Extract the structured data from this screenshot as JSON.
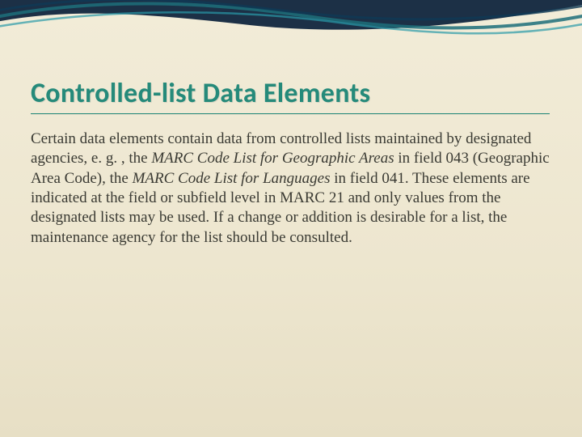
{
  "slide": {
    "title": "Controlled-list Data Elements",
    "body": {
      "t1": "Certain data elements contain data from controlled lists maintained by designated agencies, e. g. , the ",
      "i1": "MARC Code List for Geographic Areas",
      "t2": " in field 043 (Geographic Area Code), the ",
      "i2": "MARC Code List for Languages ",
      "t3": " in field 041. These elements are indicated at the field or subfield level in MARC 21 and only values from the designated lists may be used. If a change or addition is desirable for a list, the maintenance agency for the list should be consulted."
    }
  },
  "colors": {
    "accent": "#258a7a",
    "swoosh_dark": "#0a1f3a",
    "swoosh_teal": "#1d6f7a"
  }
}
